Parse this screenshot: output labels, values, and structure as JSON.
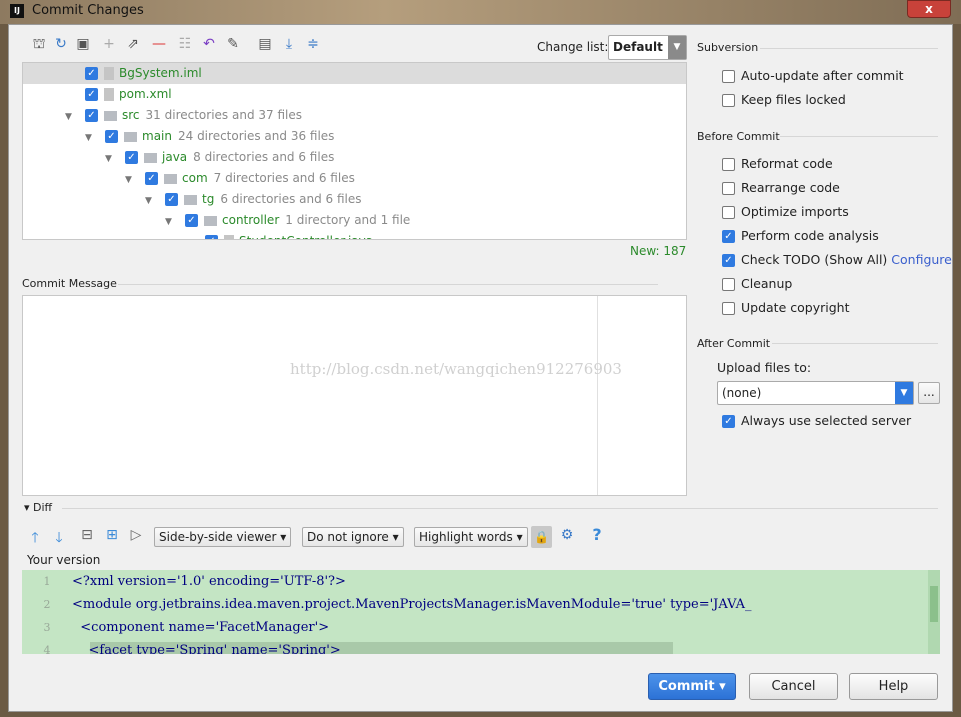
{
  "window": {
    "title": "Commit Changes",
    "close_label": "x"
  },
  "toolbar": {
    "icons": [
      "diff-icon",
      "refresh-icon",
      "changelist-icon",
      "add-icon",
      "move-icon",
      "remove-icon",
      "group-icon",
      "revert-icon",
      "edit-icon",
      "expand-all-toggle-icon",
      "expand-icon",
      "collapse-icon"
    ],
    "change_list_label": "Change list:",
    "change_list_value": "Default"
  },
  "tree": {
    "rows": [
      {
        "name": "BgSystem.iml",
        "count": "",
        "level": 0,
        "folder": false,
        "selected": true
      },
      {
        "name": "pom.xml",
        "count": "",
        "level": 0,
        "folder": false
      },
      {
        "name": "src",
        "count": "31 directories and 37 files",
        "level": 0,
        "folder": true
      },
      {
        "name": "main",
        "count": "24 directories and 36 files",
        "level": 1,
        "folder": true
      },
      {
        "name": "java",
        "count": "8 directories and 6 files",
        "level": 2,
        "folder": true
      },
      {
        "name": "com",
        "count": "7 directories and 6 files",
        "level": 3,
        "folder": true
      },
      {
        "name": "tg",
        "count": "6 directories and 6 files",
        "level": 4,
        "folder": true
      },
      {
        "name": "controller",
        "count": "1 directory and 1 file",
        "level": 5,
        "folder": true
      },
      {
        "name": "StudentController.java",
        "count": "",
        "level": 6,
        "folder": false
      }
    ],
    "status": "New: 187"
  },
  "commit_message": {
    "label": "Commit Message",
    "value": "",
    "watermark": "http://blog.csdn.net/wangqichen912276903"
  },
  "subversion": {
    "title": "Subversion",
    "options": [
      {
        "label": "Auto-update after commit",
        "checked": false
      },
      {
        "label": "Keep files locked",
        "checked": false
      }
    ]
  },
  "before_commit": {
    "title": "Before Commit",
    "options": [
      {
        "label": "Reformat code",
        "checked": false
      },
      {
        "label": "Rearrange code",
        "checked": false
      },
      {
        "label": "Optimize imports",
        "checked": false
      },
      {
        "label": "Perform code analysis",
        "checked": true
      },
      {
        "label": "Check TODO (Show All)",
        "checked": true,
        "link": "Configure"
      },
      {
        "label": "Cleanup",
        "checked": false
      },
      {
        "label": "Update copyright",
        "checked": false
      }
    ]
  },
  "after_commit": {
    "title": "After Commit",
    "upload_label": "Upload files to:",
    "upload_value": "(none)",
    "browse_label": "...",
    "always_label": "Always use selected server",
    "always_checked": true
  },
  "diff": {
    "title": "Diff",
    "viewer": "Side-by-side viewer",
    "ignore": "Do not ignore",
    "highlight": "Highlight words",
    "help": "?",
    "version_label": "Your version",
    "lines": [
      {
        "n": "1",
        "text": "<?xml version='1.0' encoding='UTF-8'?>"
      },
      {
        "n": "2",
        "text": "<module org.jetbrains.idea.maven.project.MavenProjectsManager.isMavenModule='true' type='JAVA_"
      },
      {
        "n": "3",
        "text": "  <component name='FacetManager'>"
      },
      {
        "n": "4",
        "text": "    <facet type='Spring' name='Spring'>"
      }
    ]
  },
  "buttons": {
    "commit": "Commit",
    "cancel": "Cancel",
    "help": "Help"
  },
  "colors": {
    "accent": "#2f7ae0",
    "added_bg": "#c4e5c4",
    "new_green": "#2b8a2b"
  }
}
